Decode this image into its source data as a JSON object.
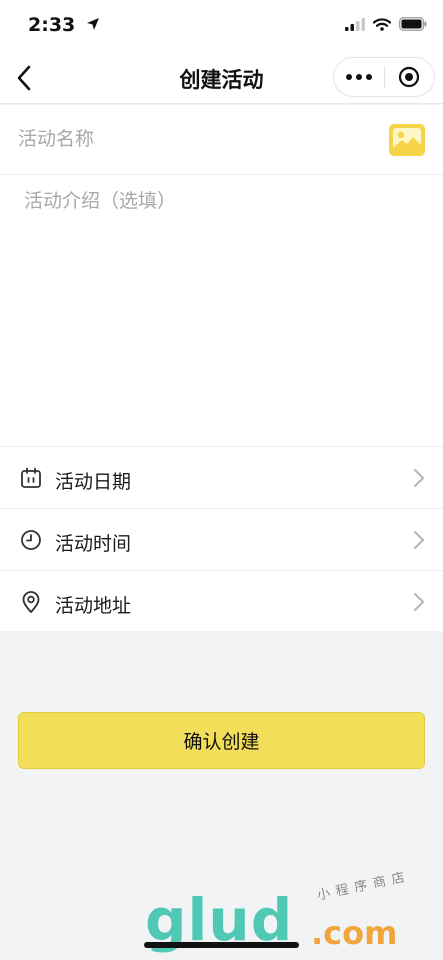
{
  "status_bar": {
    "time": "2:33",
    "icons": [
      "location-arrow-icon",
      "signal-icon",
      "wifi-icon",
      "battery-icon"
    ]
  },
  "nav": {
    "title": "创建活动",
    "back_icon": "chevron-left-icon",
    "more_icon": "more-dots-icon",
    "close_icon": "target-circle-icon"
  },
  "form": {
    "name_placeholder": "活动名称",
    "image_icon": "image-icon",
    "intro_placeholder": "活动介绍（选填）",
    "options": [
      {
        "label": "活动日期",
        "icon": "calendar-icon"
      },
      {
        "label": "活动时间",
        "icon": "clock-icon"
      },
      {
        "label": "活动地址",
        "icon": "location-pin-icon"
      }
    ]
  },
  "confirm_label": "确认创建",
  "watermark": {
    "logo": "glud",
    "domain": ".com",
    "tagline": "小程序商店"
  },
  "colors": {
    "accent_yellow": "#f2de58",
    "image_icon_yellow": "#f5d547",
    "watermark_teal": "#4fc9b4",
    "watermark_orange": "#f2a53c"
  }
}
